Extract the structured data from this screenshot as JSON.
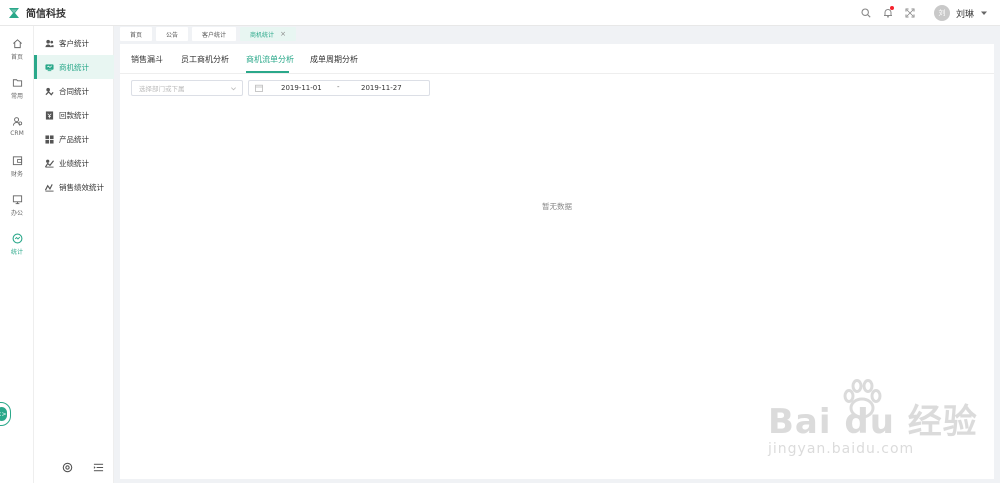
{
  "brand": {
    "name": "简信科技"
  },
  "header": {
    "user": {
      "avatar_text": "刘",
      "name": "刘琳"
    }
  },
  "leftnav": {
    "items": [
      {
        "label": "首页",
        "icon": "home-icon"
      },
      {
        "label": "常用",
        "icon": "folder-icon"
      },
      {
        "label": "CRM",
        "icon": "users-icon"
      },
      {
        "label": "财务",
        "icon": "wallet-icon"
      },
      {
        "label": "办公",
        "icon": "monitor-icon"
      },
      {
        "label": "统计",
        "icon": "chart-circle-icon",
        "active": true
      }
    ]
  },
  "submenu": {
    "items": [
      {
        "label": "客户统计",
        "icon": "customers-icon"
      },
      {
        "label": "商机统计",
        "icon": "opportunity-icon",
        "active": true
      },
      {
        "label": "合同统计",
        "icon": "contract-icon"
      },
      {
        "label": "回款统计",
        "icon": "payment-icon"
      },
      {
        "label": "产品统计",
        "icon": "product-icon"
      },
      {
        "label": "业绩统计",
        "icon": "performance-icon"
      },
      {
        "label": "销售绩效统计",
        "icon": "sales-performance-icon"
      }
    ]
  },
  "page_tabs": [
    {
      "label": "首页"
    },
    {
      "label": "公告"
    },
    {
      "label": "客户统计"
    },
    {
      "label": "商机统计",
      "active": true,
      "close": "×"
    }
  ],
  "sub_tabs": [
    {
      "label": "销售漏斗"
    },
    {
      "label": "员工商机分析"
    },
    {
      "label": "商机流单分析",
      "active": true
    },
    {
      "label": "成单周期分析"
    }
  ],
  "filters": {
    "department_placeholder": "选择部门或下属",
    "date_start": "2019-11-01",
    "date_sep": "-",
    "date_end": "2019-11-27"
  },
  "empty_text": "暂无数据",
  "float_button": {
    "label": "<>"
  },
  "watermark": {
    "main": "Bai du 经验",
    "url": "jingyan.baidu.com"
  },
  "colors": {
    "accent": "#2aa88a",
    "active_bg": "#e8f6f2",
    "badge": "#f5222d"
  }
}
